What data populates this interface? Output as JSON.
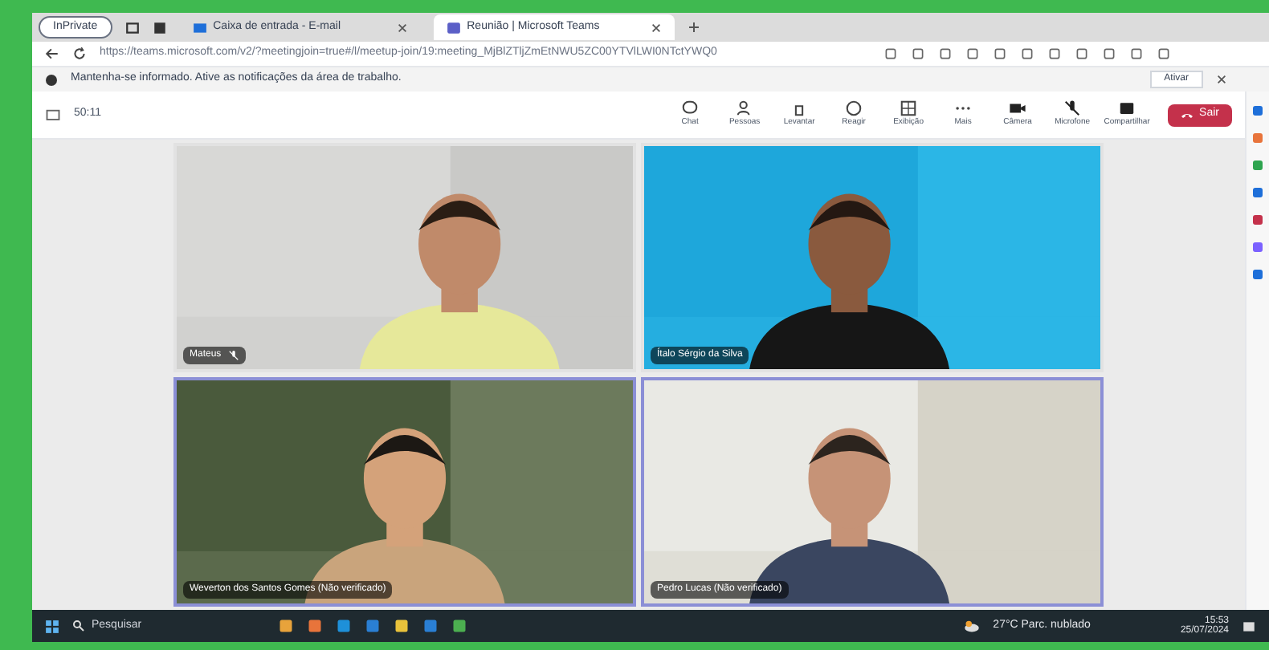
{
  "browser": {
    "profile_label": "InPrivate",
    "tabs": [
      {
        "title": "Caixa de entrada - E-mail",
        "selected": false
      },
      {
        "title": "Reunião | Microsoft Teams",
        "selected": true
      }
    ],
    "url": "https://teams.microsoft.com/v2/?meetingjoin=true#/l/meetup-join/19:meeting_MjBlZTljZmEtNWU5ZC00YTVlLWI0NTctYWQ0",
    "infobar": {
      "text": "Mantenha-se informado. Ative as notificações da área de trabalho.",
      "button": "Ativar"
    }
  },
  "meeting": {
    "timer": "50:11",
    "toolbar": [
      {
        "kind": "chat",
        "label": "Chat"
      },
      {
        "kind": "people",
        "label": "Pessoas"
      },
      {
        "kind": "raise",
        "label": "Levantar"
      },
      {
        "kind": "react",
        "label": "Reagir"
      },
      {
        "kind": "view",
        "label": "Exibição"
      },
      {
        "kind": "more",
        "label": "Mais"
      },
      {
        "kind": "camera",
        "label": "Câmera"
      },
      {
        "kind": "mic",
        "label": "Microfone"
      },
      {
        "kind": "share",
        "label": "Compartilhar"
      }
    ],
    "leave": "Sair"
  },
  "participants": [
    {
      "name": "Mateus",
      "muted": true,
      "highlighted": false
    },
    {
      "name": "Ítalo Sérgio da Silva",
      "muted": false,
      "highlighted": false
    },
    {
      "name": "Weverton dos Santos Gomes (Não verificado)",
      "muted": false,
      "highlighted": true
    },
    {
      "name": "Pedro Lucas (Não verificado)",
      "muted": false,
      "highlighted": true
    }
  ],
  "taskbar": {
    "search": "Pesquisar",
    "weather": "27°C Parc. nublado",
    "time": "15:53",
    "date": "25/07/2024"
  }
}
